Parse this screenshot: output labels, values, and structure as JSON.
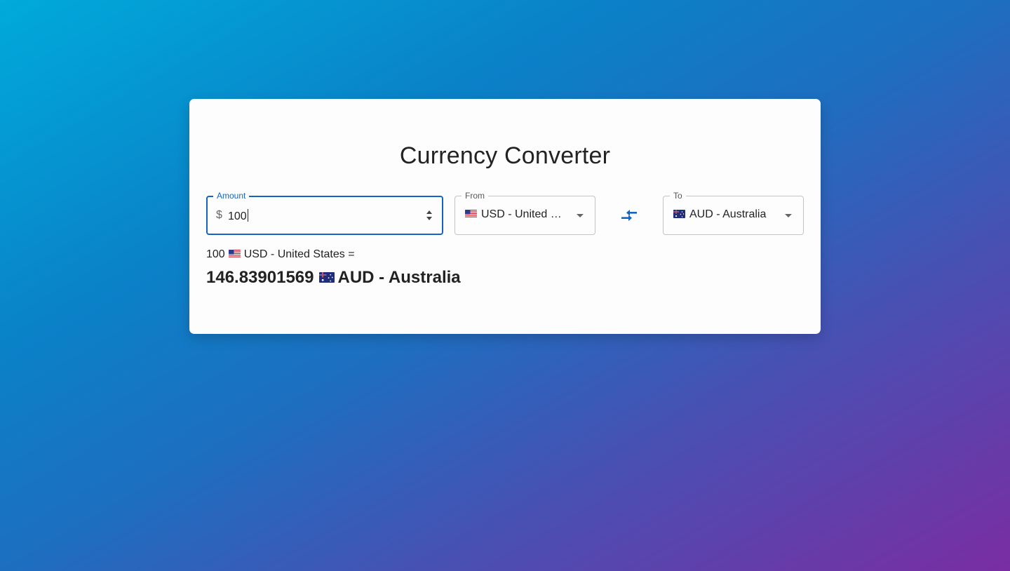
{
  "title": "Currency Converter",
  "amount": {
    "label": "Amount",
    "prefix": "$",
    "value": "100"
  },
  "from": {
    "label": "From",
    "value": "USD - United S...",
    "flag": "us-flag"
  },
  "to": {
    "label": "To",
    "value": "AUD - Australia",
    "flag": "au-flag"
  },
  "swap_icon": "swap-arrows-icon",
  "result": {
    "source_amount": "100",
    "source_currency": "USD - United States",
    "equals": "=",
    "converted_amount": "146.83901569",
    "target_currency": "AUD - Australia"
  },
  "colors": {
    "accent": "#1565c0",
    "card_bg": "#fdfdfd",
    "gradient_start": "#00aadb",
    "gradient_end": "#7a2da2"
  }
}
